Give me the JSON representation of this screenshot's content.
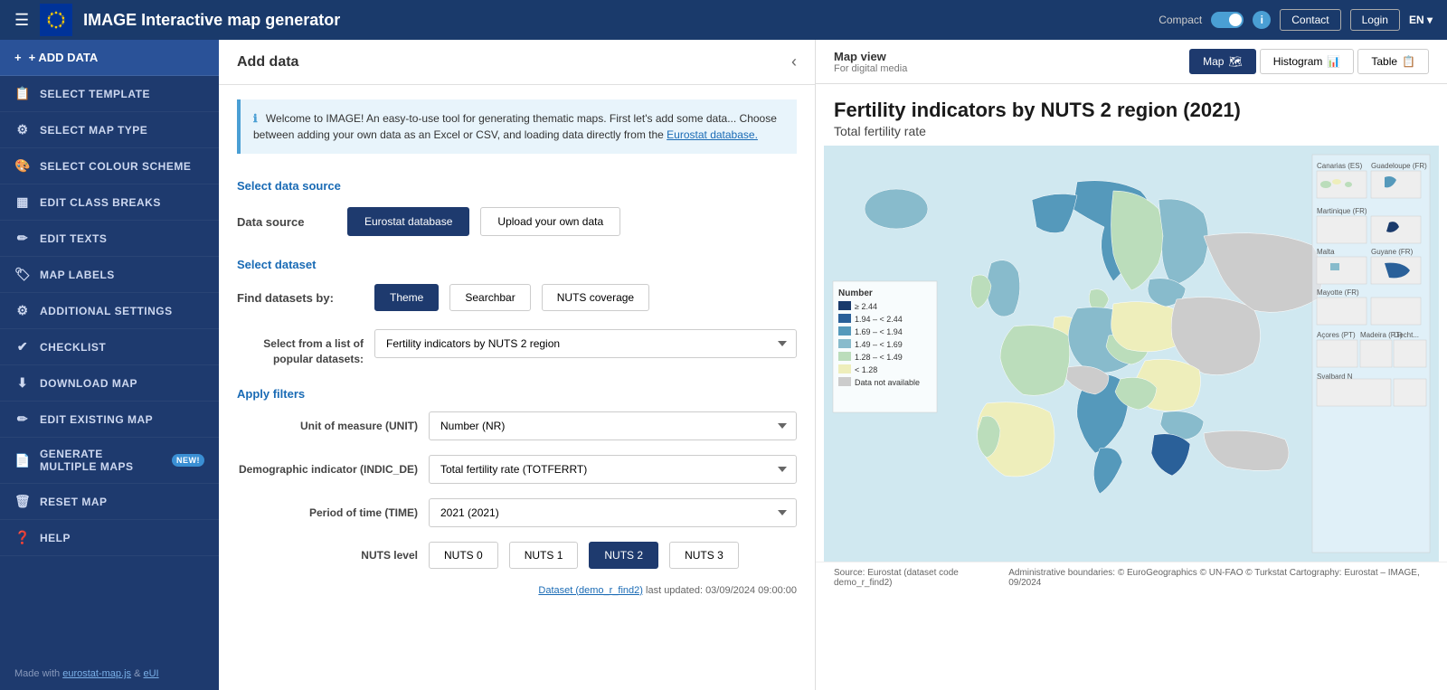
{
  "topbar": {
    "title": "IMAGE Interactive map generator",
    "compact_label": "Compact",
    "contact_btn": "Contact",
    "login_btn": "Login",
    "lang_btn": "EN ▾"
  },
  "sidebar": {
    "add_data": "+ ADD DATA",
    "items": [
      {
        "id": "select-template",
        "label": "SELECT TEMPLATE",
        "icon": "📋"
      },
      {
        "id": "select-map-type",
        "label": "SELECT MAP TYPE",
        "icon": "⚙"
      },
      {
        "id": "select-colour-scheme",
        "label": "SELECT COLOUR SCHEME",
        "icon": "🎨"
      },
      {
        "id": "edit-class-breaks",
        "label": "EDIT CLASS BREAKS",
        "icon": "▦"
      },
      {
        "id": "edit-texts",
        "label": "EDIT TEXTS",
        "icon": "✏"
      },
      {
        "id": "map-labels",
        "label": "MAP LABELS",
        "icon": "🏷"
      },
      {
        "id": "additional-settings",
        "label": "ADDITIONAL SETTINGS",
        "icon": "⚙"
      },
      {
        "id": "checklist",
        "label": "CHECKLIST",
        "icon": "✔"
      },
      {
        "id": "download-map",
        "label": "DOWNLOAD MAP",
        "icon": "⬇"
      },
      {
        "id": "edit-existing-map",
        "label": "EDIT EXISTING MAP",
        "icon": "✏"
      },
      {
        "id": "generate-multiple-maps",
        "label": "GENERATE MULTIPLE MAPS",
        "icon": "📄",
        "badge": "NEW!"
      },
      {
        "id": "reset-map",
        "label": "RESET MAP",
        "icon": "🗑"
      },
      {
        "id": "help",
        "label": "HELP",
        "icon": "❓"
      }
    ],
    "footer": "Made with ",
    "footer_link1": "eurostat-map.js",
    "footer_link2": "eUI"
  },
  "add_data_panel": {
    "title": "Add data",
    "info_text": "Welcome to IMAGE! An easy-to-use tool for generating thematic maps. First let's add some data... Choose between adding your own data as an Excel or CSV, and loading data directly from the ",
    "info_link": "Eurostat database.",
    "select_data_source_label": "Select data source",
    "data_source_label": "Data source",
    "eurostat_btn": "Eurostat database",
    "upload_btn": "Upload your own data",
    "select_dataset_label": "Select dataset",
    "find_datasets_label": "Find datasets by:",
    "theme_btn": "Theme",
    "searchbar_btn": "Searchbar",
    "nuts_coverage_btn": "NUTS coverage",
    "select_from_list_label": "Select from a list of popular datasets:",
    "selected_dataset": "Fertility indicators by NUTS 2 region",
    "apply_filters_label": "Apply filters",
    "unit_label": "Unit of measure (UNIT)",
    "unit_value": "Number (NR)",
    "demographic_label": "Demographic indicator (INDIC_DE)",
    "demographic_value": "Total fertility rate (TOTFERRT)",
    "time_label": "Period of time (TIME)",
    "time_value": "2021 (2021)",
    "nuts_level_label": "NUTS level",
    "nuts_buttons": [
      "NUTS 0",
      "NUTS 1",
      "NUTS 2",
      "NUTS 3"
    ],
    "nuts_active": "NUTS 2",
    "dataset_link": "Dataset (demo_r_find2)",
    "dataset_updated": "last updated: 03/09/2024 09:00:00"
  },
  "map_panel": {
    "map_view_label": "Map view",
    "for_label": "For digital media",
    "tab_map": "Map",
    "tab_histogram": "Histogram",
    "tab_table": "Table",
    "main_title": "Fertility indicators by NUTS 2 region (2021)",
    "sub_title": "Total fertility rate",
    "legend_title": "Number",
    "legend_items": [
      {
        "color": "#1a3a6b",
        "label": "≥ 2.44"
      },
      {
        "color": "#2a6099",
        "label": "1.94 – < 2.44"
      },
      {
        "color": "#5599bb",
        "label": "1.69 – < 1.94"
      },
      {
        "color": "#88bbcc",
        "label": "1.49 – < 1.69"
      },
      {
        "color": "#bbddbb",
        "label": "1.28 – < 1.49"
      },
      {
        "color": "#eeeebb",
        "label": "< 1.28"
      },
      {
        "color": "#cccccc",
        "label": "Data not available"
      }
    ],
    "source_text": "Source: Eurostat (dataset code demo_r_find2)",
    "admin_text": "Administrative boundaries: © EuroGeographics © UN-FAO © Turkstat   Cartography: Eurostat – IMAGE, 09/2024"
  }
}
